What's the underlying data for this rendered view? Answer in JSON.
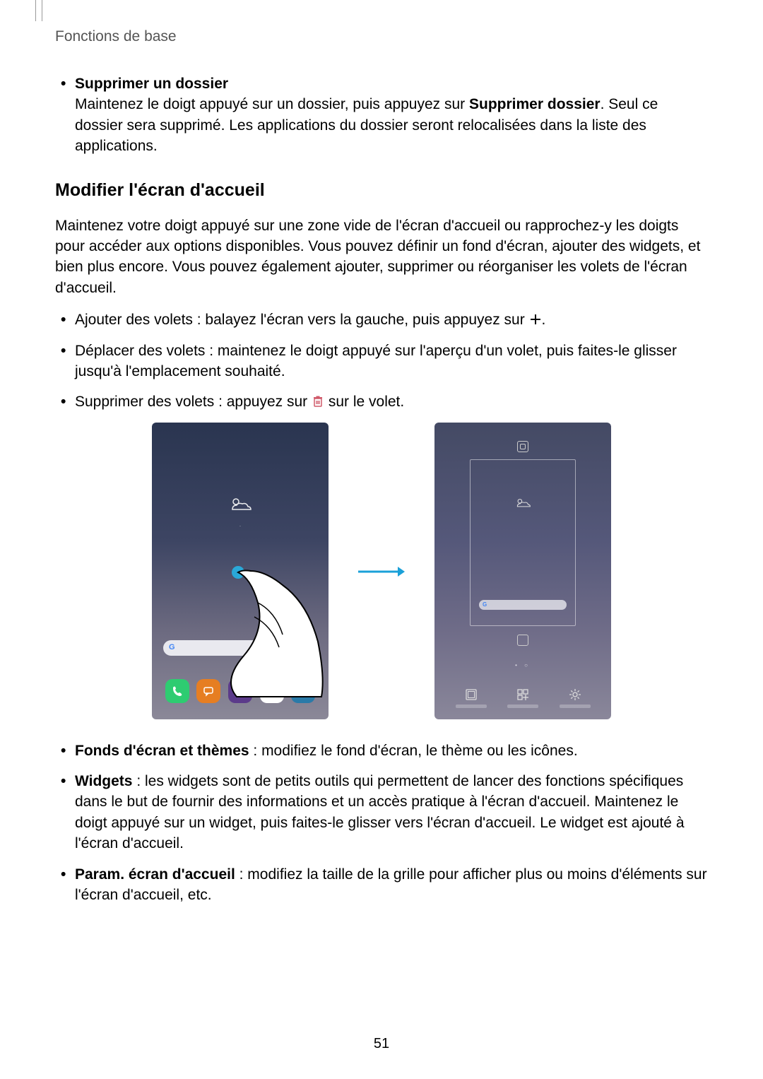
{
  "header": {
    "breadcrumb": "Fonctions de base"
  },
  "section1": {
    "title": "Supprimer un dossier",
    "text_before": "Maintenez le doigt appuyé sur un dossier, puis appuyez sur ",
    "action_bold": "Supprimer dossier",
    "text_after": ". Seul ce dossier sera supprimé. Les applications du dossier seront relocalisées dans la liste des applications."
  },
  "section2": {
    "heading": "Modifier l'écran d'accueil",
    "intro": "Maintenez votre doigt appuyé sur une zone vide de l'écran d'accueil ou rapprochez-y les doigts pour accéder aux options disponibles. Vous pouvez définir un fond d'écran, ajouter des widgets, et bien plus encore. Vous pouvez également ajouter, supprimer ou réorganiser les volets de l'écran d'accueil.",
    "bullets_top": [
      {
        "before": "Ajouter des volets : balayez l'écran vers la gauche, puis appuyez sur ",
        "after": "."
      },
      {
        "text": "Déplacer des volets : maintenez le doigt appuyé sur l'aperçu d'un volet, puis faites-le glisser jusqu'à l'emplacement souhaité."
      },
      {
        "before": "Supprimer des volets : appuyez sur ",
        "after": " sur le volet."
      }
    ],
    "bullets_bottom": [
      {
        "bold": "Fonds d'écran et thèmes",
        "rest": " : modifiez le fond d'écran, le thème ou les icônes."
      },
      {
        "bold": "Widgets",
        "rest": " : les widgets sont de petits outils qui permettent de lancer des fonctions spécifiques dans le but de fournir des informations et un accès pratique à l'écran d'accueil. Maintenez le doigt appuyé sur un widget, puis faites-le glisser vers l'écran d'accueil. Le widget est ajouté à l'écran d'accueil."
      },
      {
        "bold": "Param. écran d'accueil",
        "rest": " : modifiez la taille de la grille pour afficher plus ou moins d'éléments sur l'écran d'accueil, etc."
      }
    ]
  },
  "page_number": "51"
}
